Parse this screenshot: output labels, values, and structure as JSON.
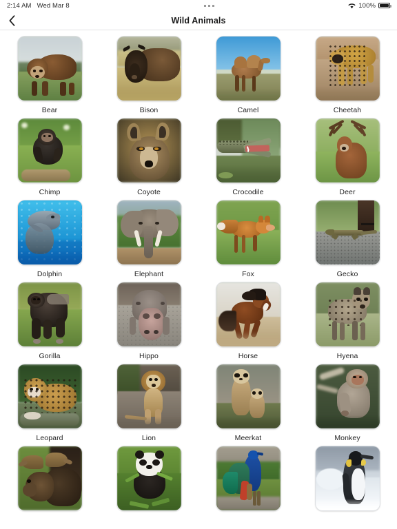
{
  "status_bar": {
    "time": "2:14 AM",
    "date": "Wed Mar 8",
    "multitask_indicator": "three-dots",
    "wifi_icon": "wifi-icon",
    "battery_percent": "100%",
    "battery_icon": "battery-full-icon"
  },
  "nav": {
    "back_icon": "chevron-left-icon",
    "title": "Wild Animals"
  },
  "grid": {
    "items": [
      {
        "label": "Bear",
        "image": "bear-photo"
      },
      {
        "label": "Bison",
        "image": "bison-photo"
      },
      {
        "label": "Camel",
        "image": "camel-photo"
      },
      {
        "label": "Cheetah",
        "image": "cheetah-photo"
      },
      {
        "label": "Chimp",
        "image": "chimp-photo"
      },
      {
        "label": "Coyote",
        "image": "coyote-photo"
      },
      {
        "label": "Crocodile",
        "image": "crocodile-photo"
      },
      {
        "label": "Deer",
        "image": "deer-photo"
      },
      {
        "label": "Dolphin",
        "image": "dolphin-photo"
      },
      {
        "label": "Elephant",
        "image": "elephant-photo"
      },
      {
        "label": "Fox",
        "image": "fox-photo"
      },
      {
        "label": "Gecko",
        "image": "gecko-photo"
      },
      {
        "label": "Gorilla",
        "image": "gorilla-photo"
      },
      {
        "label": "Hippo",
        "image": "hippo-photo"
      },
      {
        "label": "Horse",
        "image": "horse-photo"
      },
      {
        "label": "Hyena",
        "image": "hyena-photo"
      },
      {
        "label": "Leopard",
        "image": "leopard-photo"
      },
      {
        "label": "Lion",
        "image": "lion-photo"
      },
      {
        "label": "Meerkat",
        "image": "meerkat-photo"
      },
      {
        "label": "Monkey",
        "image": "monkey-photo"
      },
      {
        "label": "",
        "image": "moose-photo"
      },
      {
        "label": "",
        "image": "panda-photo"
      },
      {
        "label": "",
        "image": "peacock-photo"
      },
      {
        "label": "",
        "image": "penguin-photo"
      }
    ]
  },
  "colors": {
    "background": "#ffffff",
    "title_text": "#1a1a1a",
    "label_text": "#242424",
    "card_border": "#dfe1e4",
    "separator": "#e2e2e4"
  }
}
